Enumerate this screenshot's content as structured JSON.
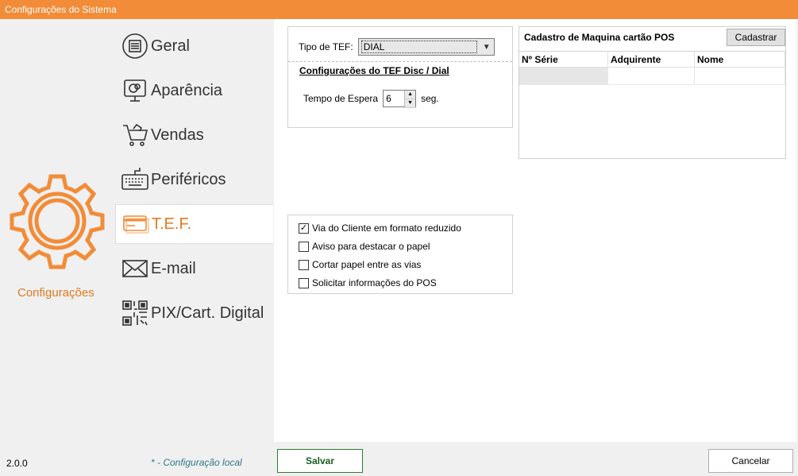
{
  "window": {
    "title": "Configurações do Sistema"
  },
  "sidebar": {
    "header_label": "Configurações",
    "items": [
      {
        "label": "Geral",
        "icon": "settings-list-icon"
      },
      {
        "label": "Aparência",
        "icon": "monitor-palette-icon"
      },
      {
        "label": "Vendas",
        "icon": "cart-icon"
      },
      {
        "label": "Periféricos",
        "icon": "keyboard-icon"
      },
      {
        "label": "T.E.F.",
        "icon": "credit-card-icon",
        "active": true
      },
      {
        "label": "E-mail",
        "icon": "envelope-icon"
      },
      {
        "label": "PIX/Cart. Digital",
        "icon": "qr-code-icon"
      }
    ]
  },
  "tef": {
    "type_label": "Tipo de TEF:",
    "type_value": "DIAL",
    "section_title": "Configurações do TEF Disc / Dial",
    "wait_label": "Tempo de Espera",
    "wait_value": "6",
    "wait_unit": "seg."
  },
  "pos": {
    "title": "Cadastro de Maquina cartão POS",
    "register_button": "Cadastrar",
    "columns": [
      "Nº Série",
      "Adquirente",
      "Nome"
    ]
  },
  "options": [
    {
      "label": "Via do Cliente em formato reduzido",
      "checked": true
    },
    {
      "label": "Aviso para destacar o papel",
      "checked": false
    },
    {
      "label": "Cortar papel entre as vias",
      "checked": false
    },
    {
      "label": "Solicitar informações do POS",
      "checked": false
    }
  ],
  "footer": {
    "version": "2.0.0",
    "local_note": "* - Configuração local",
    "save_label": "Salvar",
    "cancel_label": "Cancelar"
  },
  "colors": {
    "accent": "#f28c38",
    "active_text": "#e07a1f",
    "save_border": "#2e7d32"
  }
}
